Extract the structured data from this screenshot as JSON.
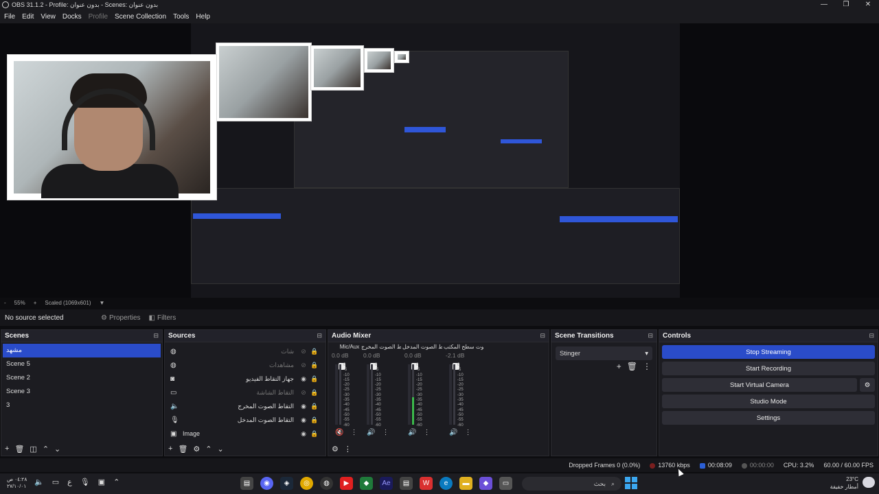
{
  "window": {
    "title": "OBS 31.1.2 - Profile: بدون عنوان - Scenes: بدون عنوان",
    "controls": [
      "—",
      "❐",
      "✕"
    ]
  },
  "menu": [
    "File",
    "Edit",
    "View",
    "Docks",
    "Profile",
    "Scene Collection",
    "Tools",
    "Help"
  ],
  "preview_footer": {
    "zoom_minus": "-",
    "zoom": "55%",
    "zoom_plus": "+",
    "scale": "Scaled (1069x601)"
  },
  "source_bar": {
    "no_source": "No source selected",
    "properties": "Properties",
    "filters": "Filters"
  },
  "scenes": {
    "title": "Scenes",
    "items": [
      "مشهد",
      "Scene 5",
      "Scene 2",
      "Scene 3",
      "3"
    ],
    "selected_index": 0
  },
  "sources": {
    "title": "Sources",
    "items": [
      {
        "icon": "globe-icon",
        "name": "شات",
        "visible": false
      },
      {
        "icon": "globe-icon",
        "name": "مشاهدات",
        "visible": false
      },
      {
        "icon": "camera-icon",
        "name": "جهاز التقاط الفيديو",
        "visible": true
      },
      {
        "icon": "window-icon",
        "name": "التقاط الشاشة",
        "visible": false
      },
      {
        "icon": "speaker-icon",
        "name": "التقاط الصوت المخرج",
        "visible": true
      },
      {
        "icon": "mic-icon",
        "name": "التقاط الصوت المدخل",
        "visible": true
      },
      {
        "icon": "image-icon",
        "name": "Image",
        "visible": true
      }
    ]
  },
  "mixer": {
    "title": "Audio Mixer",
    "channels": [
      {
        "name": "Mic/Aux",
        "db": "0.0 dB",
        "muted": true,
        "level": 0.0
      },
      {
        "name": "التقاط الصوت المخرج",
        "db": "0.0 dB",
        "muted": false,
        "level": 0.0
      },
      {
        "name": "التقاط الصوت المدخل",
        "db": "0.0 dB",
        "muted": false,
        "level": 0.45
      },
      {
        "name": "صوت سطح المكتب",
        "db": "-2.1 dB",
        "muted": false,
        "level": 0.0
      }
    ],
    "scale": [
      "0",
      "-5",
      "-10",
      "-15",
      "-20",
      "-25",
      "-30",
      "-35",
      "-40",
      "-45",
      "-50",
      "-55",
      "-60"
    ]
  },
  "transitions": {
    "title": "Scene Transitions",
    "selected": "Stinger"
  },
  "controls": {
    "title": "Controls",
    "stop_streaming": "Stop Streaming",
    "start_recording": "Start Recording",
    "start_virtual_camera": "Start Virtual Camera",
    "studio_mode": "Studio Mode",
    "settings": "Settings"
  },
  "status": {
    "dropped_frames": "Dropped Frames 0 (0.0%)",
    "bitrate": "13760 kbps",
    "stream_time": "00:08:09",
    "record_time": "00:00:00",
    "cpu": "CPU: 3.2%",
    "fps": "60.00 / 60.00 FPS"
  },
  "taskbar": {
    "time": "٠٤:٢٨ ص",
    "date": "٢٧/١٠/٠١",
    "lang": "ع",
    "search_placeholder": "بحث",
    "weather_temp": "23°C",
    "weather_desc": "أمطار خفيفة",
    "colors": {
      "accent": "#2a4cc9",
      "green_meter": "#3cba4b"
    }
  }
}
